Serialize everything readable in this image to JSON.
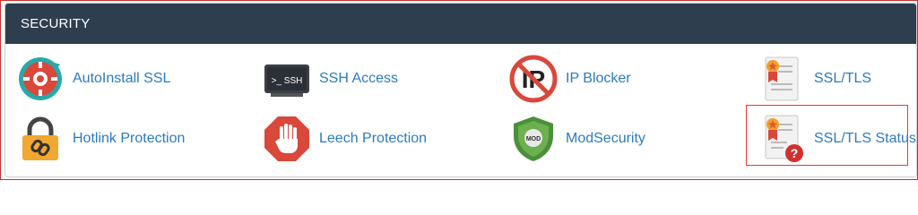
{
  "section": {
    "title": "SECURITY"
  },
  "items": [
    {
      "label": "AutoInstall SSL",
      "icon": "autoinstall-ssl-icon"
    },
    {
      "label": "SSH Access",
      "icon": "ssh-terminal-icon",
      "icon_text": ">_ SSH"
    },
    {
      "label": "IP Blocker",
      "icon": "ip-blocker-icon",
      "icon_text": "IP"
    },
    {
      "label": "SSL/TLS",
      "icon": "ssl-certificate-icon"
    },
    {
      "label": "Hotlink Protection",
      "icon": "padlock-chain-icon"
    },
    {
      "label": "Leech Protection",
      "icon": "stop-hand-icon"
    },
    {
      "label": "ModSecurity",
      "icon": "mod-shield-icon",
      "icon_text": "MOD"
    },
    {
      "label": "SSL/TLS Status",
      "icon": "ssl-status-icon",
      "icon_text": "?"
    }
  ],
  "colors": {
    "header_bg": "#2f3e4f",
    "link": "#2a7bbf",
    "highlight": "#e53935"
  }
}
